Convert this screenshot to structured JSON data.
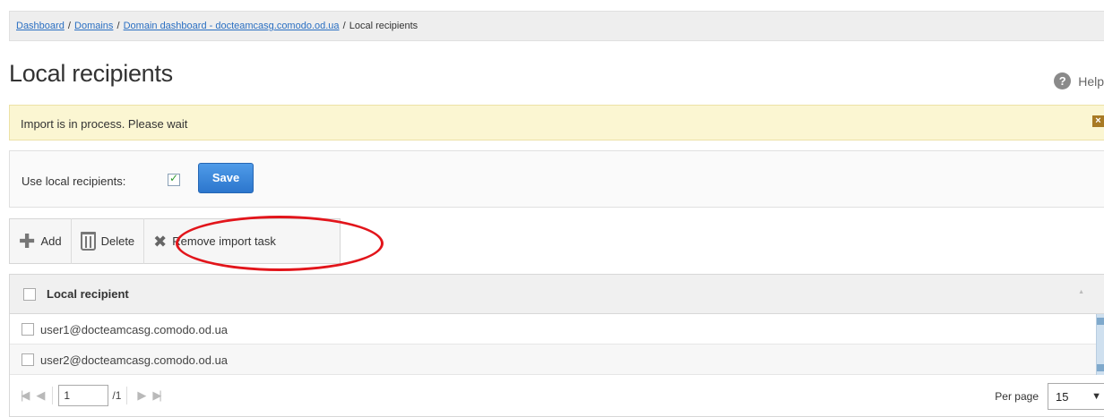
{
  "breadcrumb": {
    "items": [
      "Dashboard",
      "Domains",
      "Domain dashboard - docteamcasg.comodo.od.ua"
    ],
    "current": "Local recipients",
    "separator": "/"
  },
  "page": {
    "title": "Local recipients",
    "help_label": "Help",
    "help_icon": "question-circle-icon"
  },
  "notice": {
    "text": "Import is in process. Please wait",
    "close_icon": "close-icon"
  },
  "settings": {
    "use_local_label": "Use local recipients:",
    "use_local_checked": true,
    "save_label": "Save"
  },
  "toolbar": {
    "add_label": "Add",
    "delete_label": "Delete",
    "remove_import_label": "Remove import task"
  },
  "table": {
    "header": "Local recipient",
    "rows": [
      "user1@docteamcasg.comodo.od.ua",
      "user2@docteamcasg.comodo.od.ua"
    ]
  },
  "pager": {
    "page": "1",
    "total": "/1",
    "per_page_label": "Per page",
    "per_page_value": "15"
  },
  "colors": {
    "link": "#2a6fc2",
    "save_button": "#2c76cd",
    "notice_bg": "#fbf6d2",
    "highlight": "#e2151b"
  }
}
